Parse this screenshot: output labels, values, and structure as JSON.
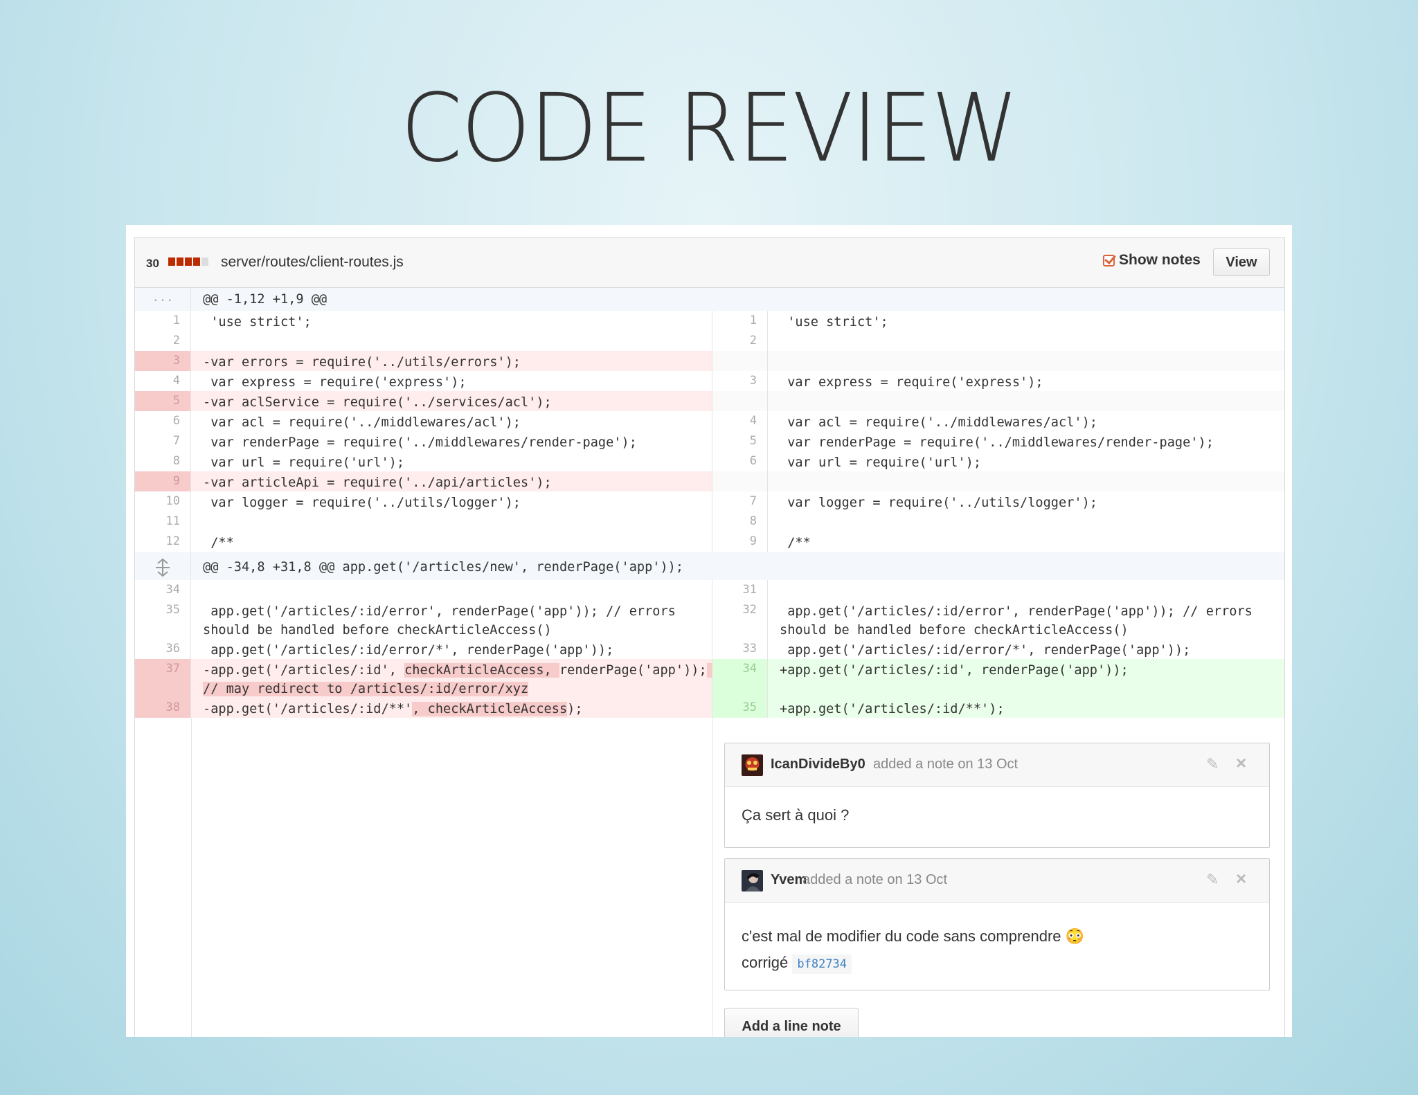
{
  "slide": {
    "title": "CODE REVIEW"
  },
  "file": {
    "changes": "30",
    "path": "server/routes/client-routes.js",
    "show_notes_label": "Show notes",
    "view_label": "View"
  },
  "hunks": [
    {
      "marker": "...",
      "header": "@@ -1,12 +1,9 @@"
    },
    {
      "marker": "expand-icon",
      "header": "@@ -34,8 +31,8 @@ app.get('/articles/new', renderPage('app'));"
    }
  ],
  "lines": [
    {
      "ln": "1",
      "left": " 'use strict';",
      "rn": "1",
      "right": " 'use strict';"
    },
    {
      "ln": "2",
      "left": "",
      "rn": "2",
      "right": ""
    },
    {
      "ln": "3",
      "left": "-var errors = require('../utils/errors');",
      "rn": "",
      "right": ""
    },
    {
      "ln": "4",
      "left": " var express = require('express');",
      "rn": "3",
      "right": " var express = require('express');"
    },
    {
      "ln": "5",
      "left": "-var aclService = require('../services/acl');",
      "rn": "",
      "right": ""
    },
    {
      "ln": "6",
      "left": " var acl = require('../middlewares/acl');",
      "rn": "4",
      "right": " var acl = require('../middlewares/acl');"
    },
    {
      "ln": "7",
      "left": " var renderPage = require('../middlewares/render-page');",
      "rn": "5",
      "right": " var renderPage = require('../middlewares/render-page');"
    },
    {
      "ln": "8",
      "left": " var url = require('url');",
      "rn": "6",
      "right": " var url = require('url');"
    },
    {
      "ln": "9",
      "left": "-var articleApi = require('../api/articles');",
      "rn": "",
      "right": ""
    },
    {
      "ln": "10",
      "left": " var logger = require('../utils/logger');",
      "rn": "7",
      "right": " var logger = require('../utils/logger');"
    },
    {
      "ln": "11",
      "left": "",
      "rn": "8",
      "right": ""
    },
    {
      "ln": "12",
      "left": " /**",
      "rn": "9",
      "right": " /**"
    },
    {
      "ln": "34",
      "left": "",
      "rn": "31",
      "right": ""
    },
    {
      "ln": "35",
      "left": " app.get('/articles/:id/error', renderPage('app')); // errors should be handled before checkArticleAccess()",
      "rn": "32",
      "right": " app.get('/articles/:id/error', renderPage('app')); // errors should be handled before checkArticleAccess()"
    },
    {
      "ln": "36",
      "left": " app.get('/articles/:id/error/*', renderPage('app'));",
      "rn": "33",
      "right": " app.get('/articles/:id/error/*', renderPage('app'));"
    },
    {
      "ln": "37",
      "left_a": "-app.get('/articles/:id', ",
      "left_hl1": "checkArticleAccess, ",
      "left_b": "renderPage('app'));",
      "left_hl2": " // may redirect to /articles/:id/error/xyz",
      "rn": "34",
      "right": "+app.get('/articles/:id', renderPage('app'));"
    },
    {
      "ln": "38",
      "left_a": "-app.get('/articles/:id/**'",
      "left_hl1": ", checkArticleAccess",
      "left_b": ");",
      "rn": "35",
      "right": "+app.get('/articles/:id/**');"
    }
  ],
  "notes": [
    {
      "author": "IcanDivideBy0",
      "meta": "added a note on 13 Oct",
      "body": "Ça sert à quoi ?"
    },
    {
      "author": "Yvem",
      "meta": "added a note on 13 Oct",
      "body": "c'est mal de modifier du code sans comprendre",
      "emoji": "😳",
      "fix_label": "corrigé",
      "sha": "bf82734"
    }
  ],
  "add_note_label": "Add a line note",
  "colors": {
    "deletion": "#ffecec",
    "addition": "#eaffea",
    "diffstat_red": "#bd2c00",
    "link": "#4183c4"
  }
}
